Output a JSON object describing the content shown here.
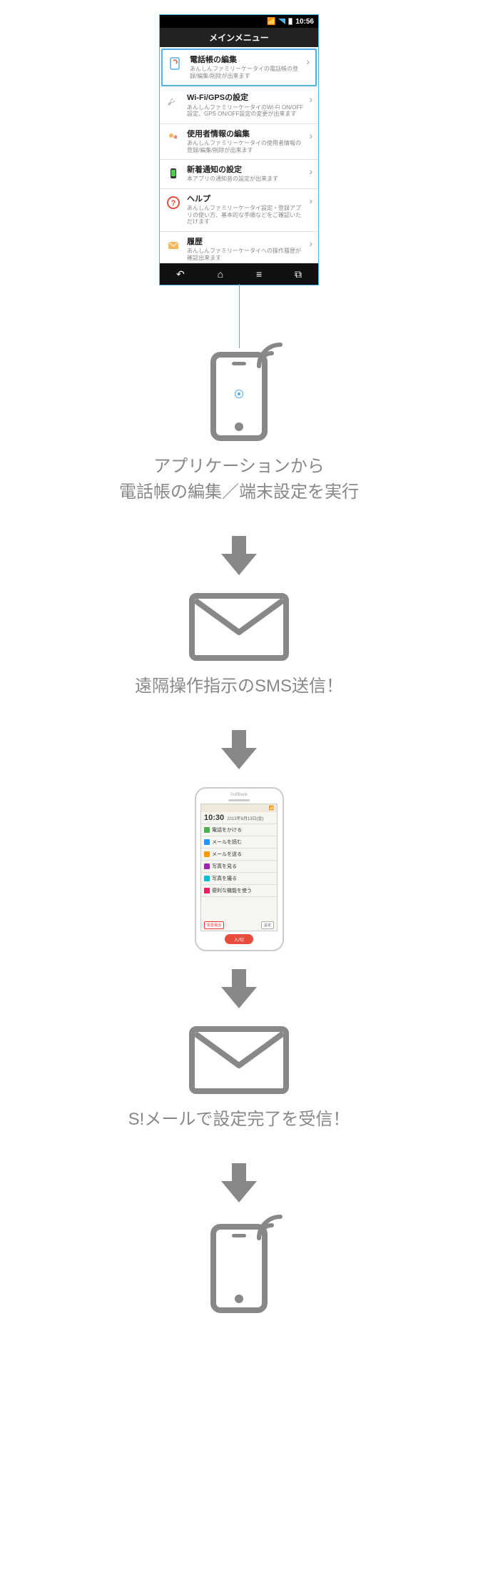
{
  "statusbar": {
    "time": "10:56"
  },
  "titlebar": "メインメニュー",
  "menu": [
    {
      "title": "電話帳の編集",
      "desc": "あんしんファミリーケータイの電話帳の登録/編集/削除が出来ます"
    },
    {
      "title": "Wi-Fi/GPSの設定",
      "desc": "あんしんファミリーケータイのWi-Fi ON/OFF設定、GPS ON/OFF設定の変更が出来ます"
    },
    {
      "title": "使用者情報の編集",
      "desc": "あんしんファミリーケータイの使用者情報の登録/編集/削除が出来ます"
    },
    {
      "title": "新着通知の設定",
      "desc": "本アプリの通知音の設定が出来ます"
    },
    {
      "title": "ヘルプ",
      "desc": "あんしんファミリーケータイ設定・登録アプリの使い方、基本的な手順などをご確認いただけます"
    },
    {
      "title": "履歴",
      "desc": "あんしんファミリーケータイへの操作履歴が確認出来ます"
    }
  ],
  "caption1_line1": "アプリケーションから",
  "caption1_line2": "電話帳の編集／端末設定を実行",
  "caption2": "遠隔操作指示のSMS送信！",
  "caption3": "S!メールで設定完了を受信！",
  "whitephone": {
    "brand": "SoftBank",
    "time": "10:30",
    "date": "2013年9月13日(金)",
    "rows": [
      {
        "label": "電話をかける",
        "color": "#4caf50"
      },
      {
        "label": "メールを読む",
        "color": "#2196f3"
      },
      {
        "label": "メールを送る",
        "color": "#ff9800"
      },
      {
        "label": "写真を見る",
        "color": "#9c27b0"
      },
      {
        "label": "写真を撮る",
        "color": "#00bcd4"
      },
      {
        "label": "便利な機能を使う",
        "color": "#e91e63"
      }
    ],
    "emergency": "緊急電話",
    "settings": "設定",
    "home": "入/切"
  }
}
